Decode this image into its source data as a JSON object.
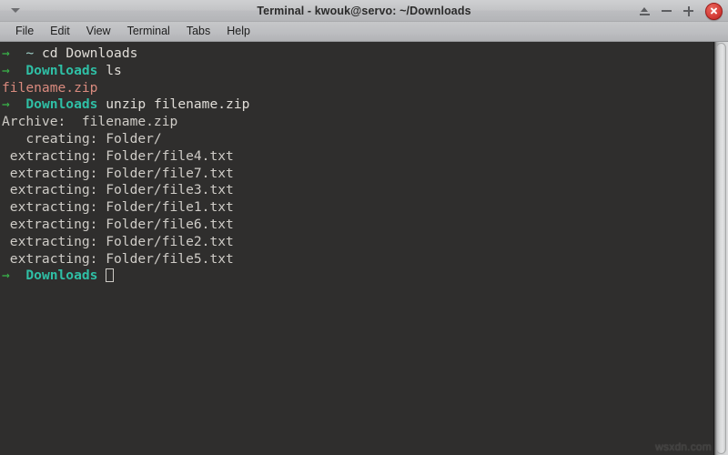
{
  "window": {
    "title": "Terminal - kwouk@servo: ~/Downloads",
    "menu_button_icon": "chevron-down-icon",
    "buttons": {
      "shade_label": "",
      "minimize_label": "",
      "maximize_label": "",
      "close_label": ""
    },
    "accent_close_color": "#d6403a"
  },
  "menubar": {
    "items": [
      {
        "label": "File"
      },
      {
        "label": "Edit"
      },
      {
        "label": "View"
      },
      {
        "label": "Terminal"
      },
      {
        "label": "Tabs"
      },
      {
        "label": "Help"
      }
    ]
  },
  "terminal": {
    "background_color": "#2f2e2d",
    "foreground_color": "#d8d5d0",
    "prompt_arrow": "→",
    "colors": {
      "arrow": "#39b54a",
      "prompt_path": "#2fbfa5",
      "home_tilde": "#9fd0c8",
      "archive_file": "#d98a7e",
      "output": "#cfccc7"
    },
    "lines": [
      {
        "type": "prompt",
        "arrow": "→",
        "path": "~",
        "path_style": "tilde",
        "command": "cd Downloads"
      },
      {
        "type": "prompt",
        "arrow": "→",
        "path": "Downloads",
        "path_style": "dir",
        "command": "ls"
      },
      {
        "type": "output",
        "style": "archive",
        "text": "filename.zip"
      },
      {
        "type": "prompt",
        "arrow": "→",
        "path": "Downloads",
        "path_style": "dir",
        "command": "unzip filename.zip"
      },
      {
        "type": "output",
        "style": "plain",
        "text": "Archive:  filename.zip"
      },
      {
        "type": "output",
        "style": "plain",
        "text": "   creating: Folder/"
      },
      {
        "type": "output",
        "style": "plain",
        "text": " extracting: Folder/file4.txt"
      },
      {
        "type": "output",
        "style": "plain",
        "text": " extracting: Folder/file7.txt"
      },
      {
        "type": "output",
        "style": "plain",
        "text": " extracting: Folder/file3.txt"
      },
      {
        "type": "output",
        "style": "plain",
        "text": " extracting: Folder/file1.txt"
      },
      {
        "type": "output",
        "style": "plain",
        "text": " extracting: Folder/file6.txt"
      },
      {
        "type": "output",
        "style": "plain",
        "text": " extracting: Folder/file2.txt"
      },
      {
        "type": "output",
        "style": "plain",
        "text": " extracting: Folder/file5.txt"
      },
      {
        "type": "prompt",
        "arrow": "→",
        "path": "Downloads",
        "path_style": "dir",
        "command": "",
        "cursor": true
      }
    ]
  },
  "scrollbar": {
    "orientation": "vertical",
    "thumb_position": "full"
  },
  "watermark": {
    "text": "wsxdn.com"
  }
}
